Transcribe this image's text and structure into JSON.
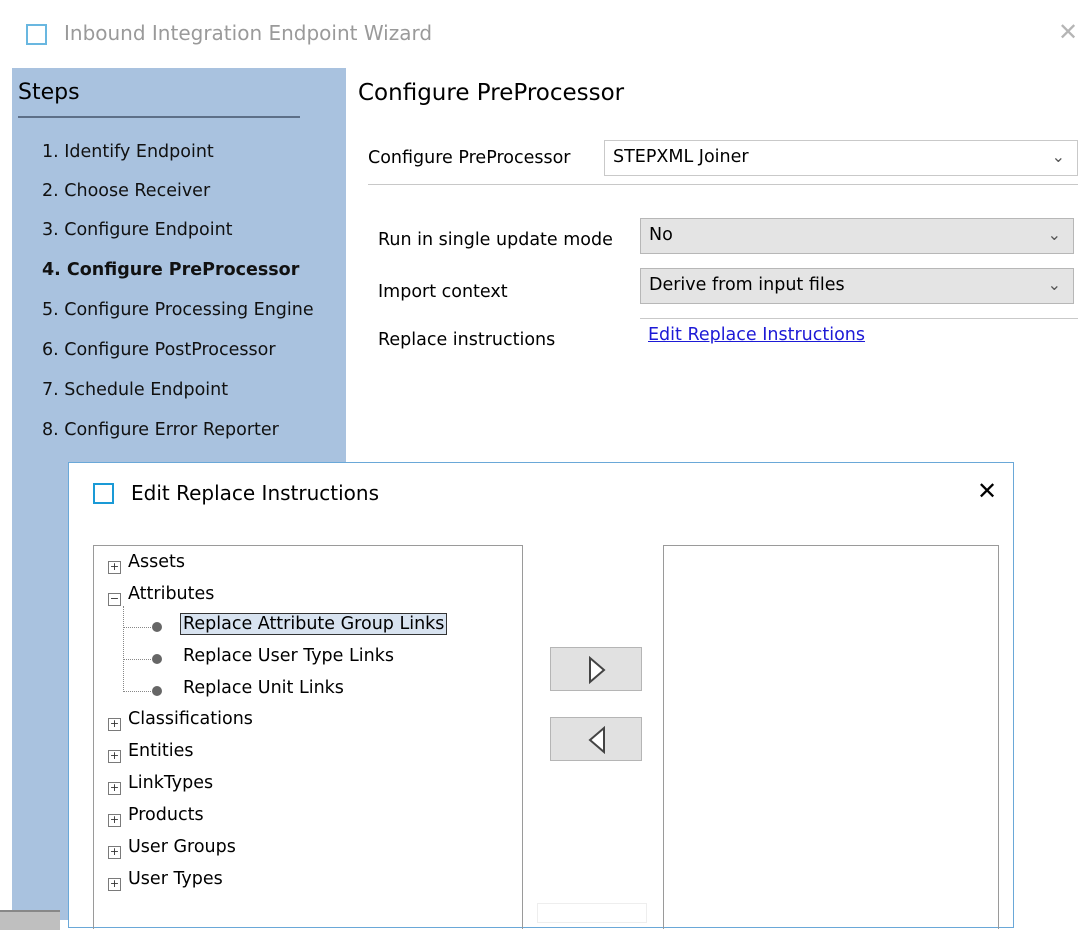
{
  "wizard": {
    "title": "Inbound Integration Endpoint Wizard",
    "close_glyph": "✕"
  },
  "sidebar": {
    "title": "Steps",
    "steps": [
      {
        "label": "1. Identify Endpoint",
        "active": false
      },
      {
        "label": "2. Choose Receiver",
        "active": false
      },
      {
        "label": "3. Configure Endpoint",
        "active": false
      },
      {
        "label": "4. Configure PreProcessor",
        "active": true
      },
      {
        "label": "5. Configure Processing Engine",
        "active": false
      },
      {
        "label": "6. Configure PostProcessor",
        "active": false
      },
      {
        "label": "7. Schedule Endpoint",
        "active": false
      },
      {
        "label": "8. Configure Error Reporter",
        "active": false
      }
    ]
  },
  "main": {
    "title": "Configure PreProcessor",
    "preprocessor": {
      "label": "Configure PreProcessor",
      "value": "STEPXML Joiner"
    },
    "fields": {
      "single_update": {
        "label": "Run in single update mode",
        "value": "No"
      },
      "import_context": {
        "label": "Import context",
        "value": "Derive from input files"
      },
      "replace_instructions": {
        "label": "Replace instructions",
        "link": "Edit Replace Instructions"
      }
    }
  },
  "dialog": {
    "title": "Edit Replace Instructions",
    "close_glyph": "✕",
    "tree": {
      "assets": "Assets",
      "attributes": "Attributes",
      "attribute_children": [
        "Replace Attribute Group Links",
        "Replace User Type Links",
        "Replace Unit Links"
      ],
      "classifications": "Classifications",
      "entities": "Entities",
      "linktypes": "LinkTypes",
      "products": "Products",
      "user_groups": "User Groups",
      "user_types": "User Types"
    },
    "selected_item": "Replace Attribute Group Links",
    "buttons": {
      "add_icon": "arrow-right-icon",
      "remove_icon": "arrow-left-icon"
    }
  },
  "colors": {
    "sidebar": "#a9c2df",
    "link": "#1d1ad6",
    "dialog_border": "#6aa8d8",
    "icon_accent": "#1a9ad6"
  }
}
